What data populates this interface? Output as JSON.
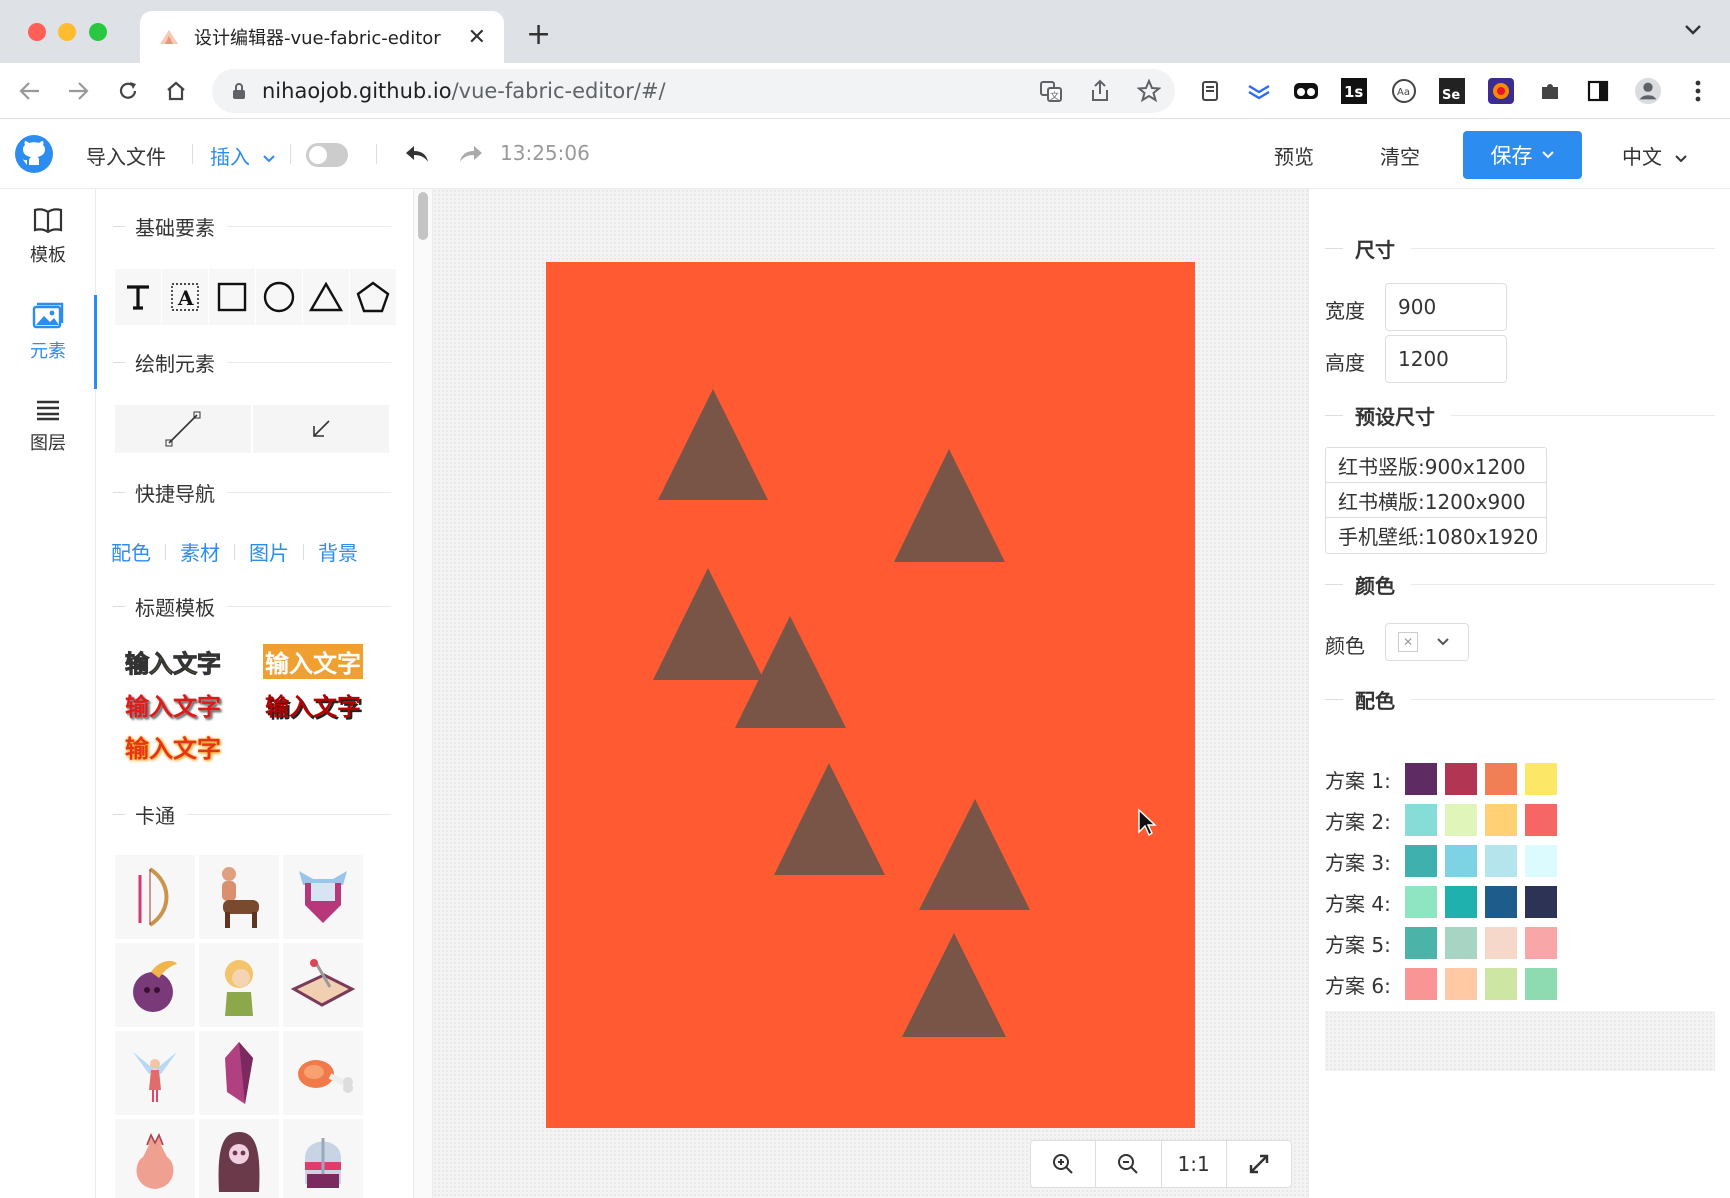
{
  "browser": {
    "tab_title": "设计编辑器-vue-fabric-editor",
    "tab_close": "✕",
    "new_tab": "+",
    "url_host": "nihaojob.github.io",
    "url_path": "/vue-fabric-editor/#/"
  },
  "header": {
    "import": "导入文件",
    "insert": "插入",
    "time": "13:25:06",
    "preview": "预览",
    "clear": "清空",
    "save": "保存",
    "language": "中文"
  },
  "leftnav": [
    {
      "label": "模板"
    },
    {
      "label": "元素"
    },
    {
      "label": "图层"
    }
  ],
  "panel": {
    "basic": "基础要素",
    "draw": "绘制元素",
    "quicknav": "快捷导航",
    "quick_links": [
      "配色",
      "素材",
      "图片",
      "背景"
    ],
    "title_tpl": "标题模板",
    "title_samples": [
      "输入文字",
      "输入文字",
      "输入文字",
      "输入文字",
      "输入文字"
    ],
    "cartoon": "卡通"
  },
  "canvas": {
    "background": "#ff5a32",
    "triangle_color": "#795548",
    "zoom_fit": "1:1"
  },
  "right": {
    "size_title": "尺寸",
    "width_label": "宽度",
    "width_value": "900",
    "height_label": "高度",
    "height_value": "1200",
    "preset_title": "预设尺寸",
    "presets": [
      "红书竖版:900x1200",
      "红书横版:1200x900",
      "手机壁纸:1080x1920"
    ],
    "color_title": "颜色",
    "color_label": "颜色",
    "palette_title": "配色",
    "schemes": [
      {
        "label": "方案 1:",
        "colors": [
          "#5f2b63",
          "#b23554",
          "#f27e56",
          "#fce766"
        ]
      },
      {
        "label": "方案 2:",
        "colors": [
          "#86dcd7",
          "#e0f5b9",
          "#ffd074",
          "#f66665"
        ]
      },
      {
        "label": "方案 3:",
        "colors": [
          "#3fb0ae",
          "#7dd3e3",
          "#b4e5ec",
          "#dcfbff"
        ]
      },
      {
        "label": "方案 4:",
        "colors": [
          "#8fe5c1",
          "#1fb1ae",
          "#1e5d8b",
          "#2d3354"
        ]
      },
      {
        "label": "方案 5:",
        "colors": [
          "#4cb3a8",
          "#a7d4c3",
          "#f6d8cb",
          "#f8a6a7"
        ]
      },
      {
        "label": "方案 6:",
        "colors": [
          "#f99595",
          "#ffc9a3",
          "#cee6a3",
          "#8fdbb1"
        ]
      }
    ]
  }
}
